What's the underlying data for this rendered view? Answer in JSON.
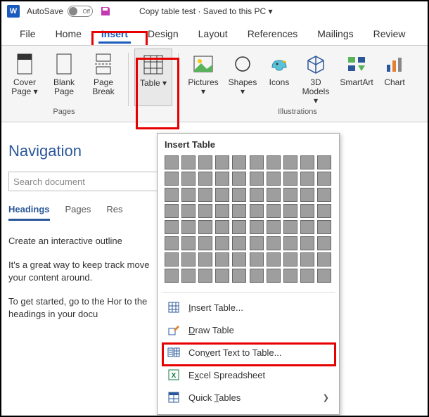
{
  "titlebar": {
    "autosave_label": "AutoSave",
    "autosave_state": "Off",
    "doc_title": "Copy table test · Saved to this PC ▾"
  },
  "tabs": [
    "File",
    "Home",
    "Insert",
    "Design",
    "Layout",
    "References",
    "Mailings",
    "Review"
  ],
  "active_tab": "Insert",
  "ribbon": {
    "pages_group_label": "Pages",
    "pages": [
      {
        "label": "Cover Page ▾"
      },
      {
        "label": "Blank Page"
      },
      {
        "label": "Page Break"
      }
    ],
    "table_label": "Table ▾",
    "illus_group_label": "Illustrations",
    "illus": [
      {
        "label": "Pictures ▾"
      },
      {
        "label": "Shapes ▾"
      },
      {
        "label": "Icons"
      },
      {
        "label": "3D Models ▾"
      },
      {
        "label": "SmartArt"
      },
      {
        "label": "Chart"
      }
    ]
  },
  "nav": {
    "title": "Navigation",
    "search_placeholder": "Search document",
    "tabs": [
      "Headings",
      "Pages",
      "Res"
    ],
    "active": "Headings",
    "paragraphs": [
      "Create an interactive outline",
      "It's a great way to keep track move your content around.",
      "To get started, go to the Hor to the headings in your docu"
    ]
  },
  "menu": {
    "header": "Insert Table",
    "grid_rows": 8,
    "grid_cols": 10,
    "items": [
      {
        "icon": "grid",
        "label": "Insert Table...",
        "key": "I"
      },
      {
        "icon": "pencil",
        "label": "Draw Table",
        "key": "D"
      },
      {
        "icon": "convert",
        "label": "Convert Text to Table...",
        "key": "V"
      },
      {
        "icon": "excel",
        "label": "Excel Spreadsheet",
        "key": "X"
      },
      {
        "icon": "quick",
        "label": "Quick Tables",
        "key": "T",
        "submenu": true
      }
    ]
  }
}
